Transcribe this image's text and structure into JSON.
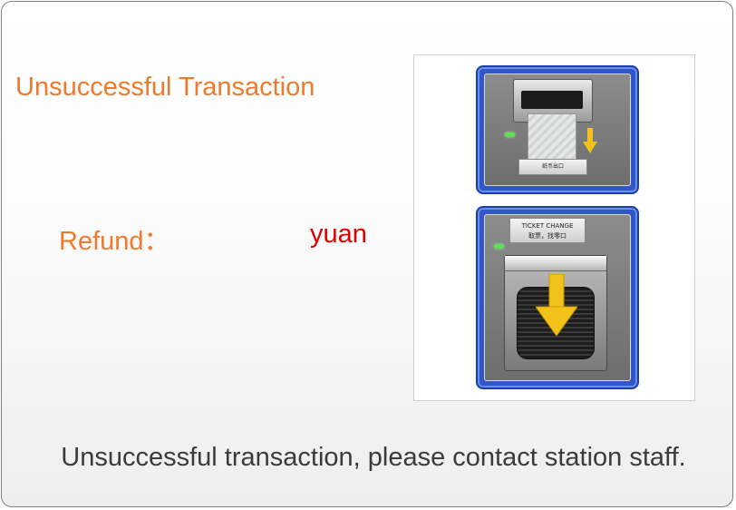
{
  "screen": {
    "title": "Unsuccessful Transaction",
    "refund": {
      "label": "Refund：",
      "amount": "",
      "unit": "yuan"
    },
    "message": "Unsuccessful transaction, please contact station staff."
  },
  "illustration": {
    "banknote_panel": {
      "plate_label": "纸币出口",
      "arrow": "down-arrow-icon"
    },
    "ticket_panel": {
      "plate_line1": "TICKET CHANGE",
      "plate_line2": "取票，找零口",
      "arrow": "down-arrow-icon"
    }
  },
  "colors": {
    "title": "#f07a2c",
    "refund_label": "#f07a2c",
    "refund_unit": "#e00000",
    "message": "#3b3b3b",
    "panel_frame": "#2f57c7",
    "arrow": "#f2c21a",
    "indicator_led": "#5fe05a"
  }
}
